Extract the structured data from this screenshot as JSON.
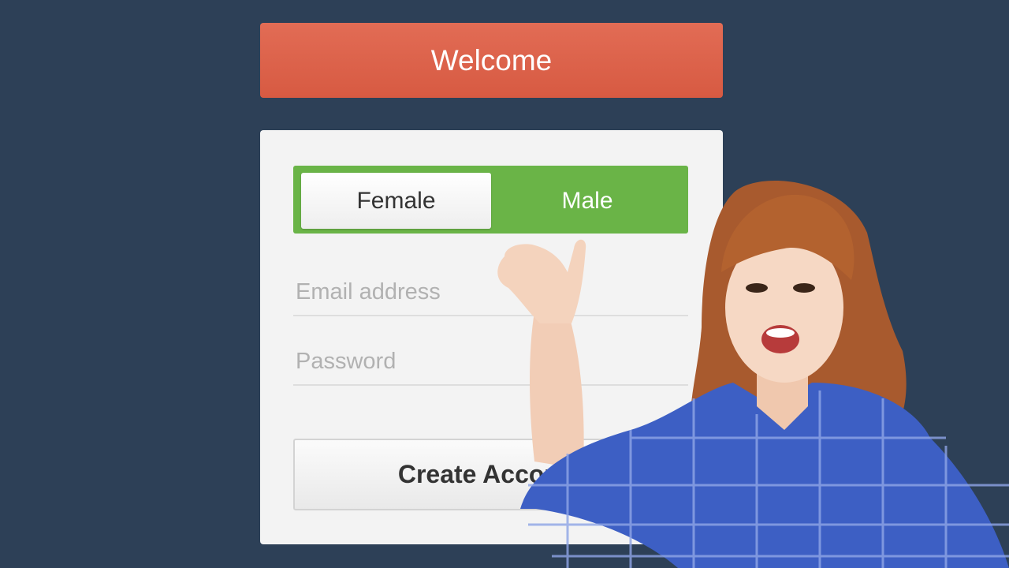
{
  "header": {
    "title": "Welcome"
  },
  "form": {
    "gender_toggle": {
      "options": [
        "Female",
        "Male"
      ],
      "selected": "Male"
    },
    "email_placeholder": "Email address",
    "password_placeholder": "Password",
    "submit_label": "Create Account"
  },
  "colors": {
    "background": "#2d4057",
    "header": "#dd6650",
    "toggle_active": "#6ab447",
    "card": "#f3f3f3"
  },
  "overlay": {
    "image": "waving-woman-photo"
  }
}
